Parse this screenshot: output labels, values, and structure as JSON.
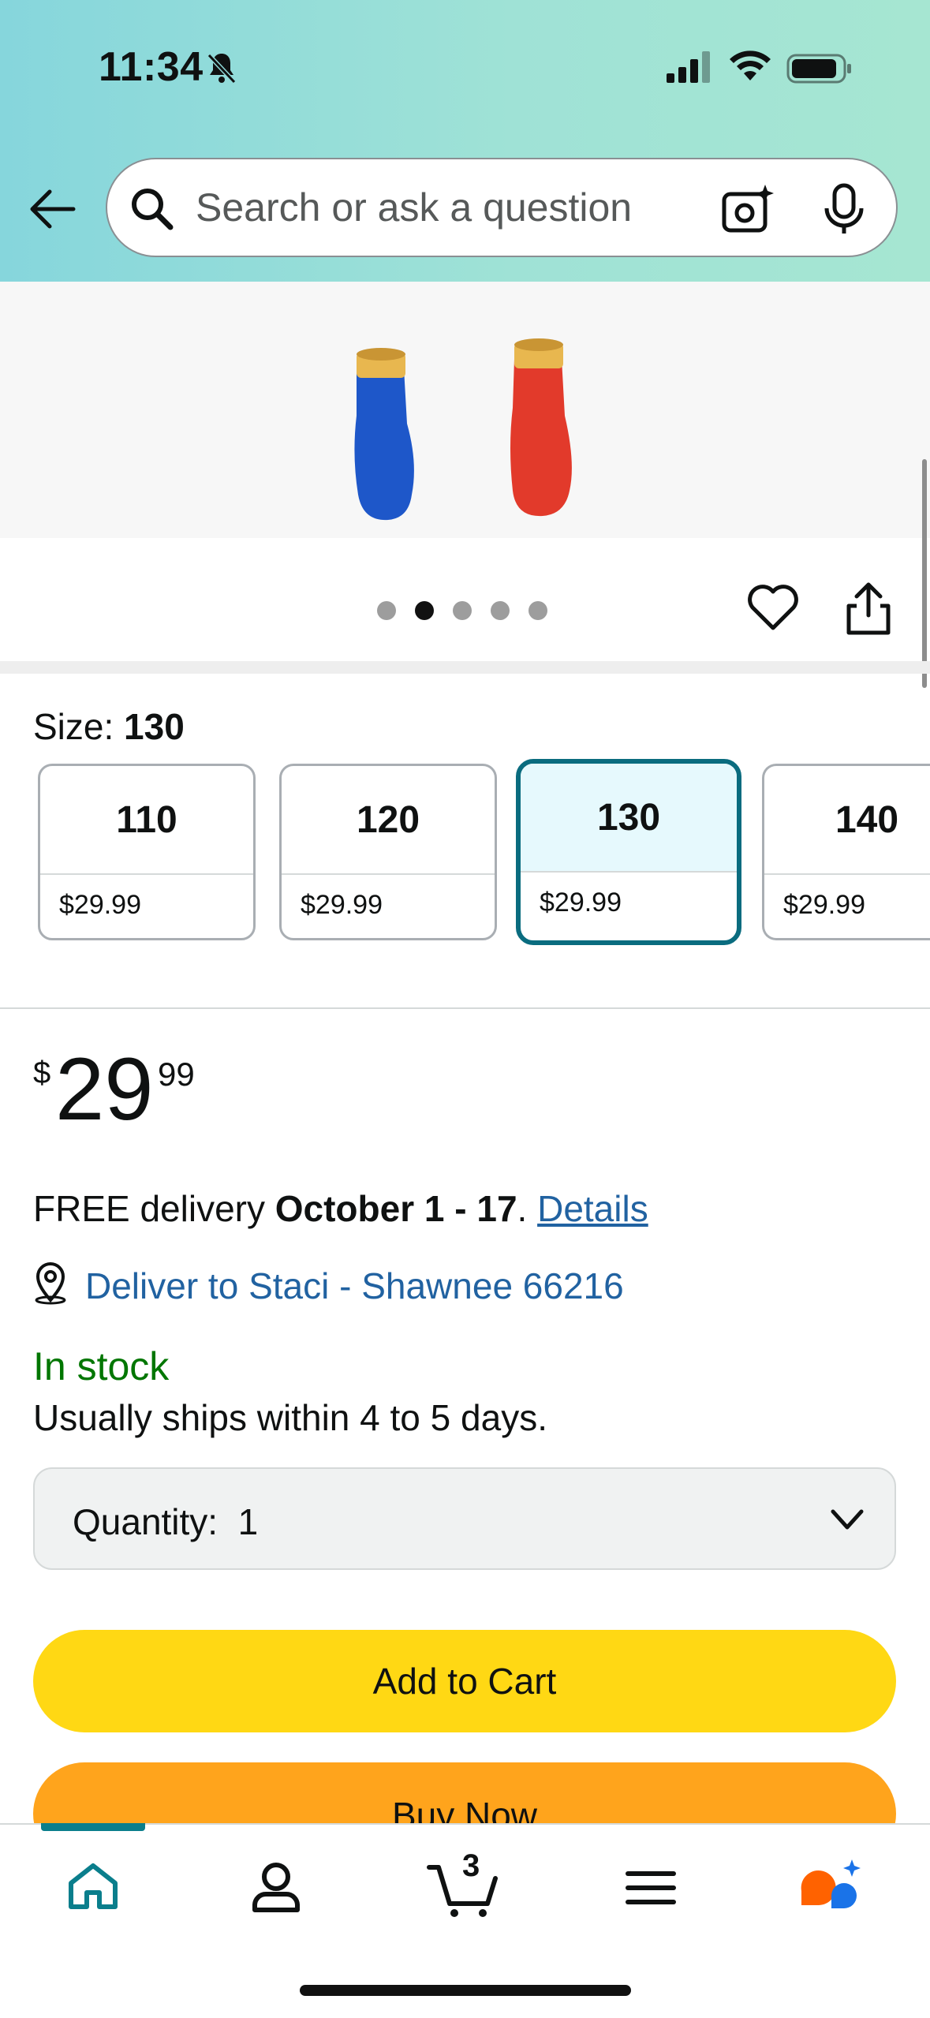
{
  "status": {
    "time": "11:34"
  },
  "search": {
    "placeholder": "Search or ask a question"
  },
  "gallery": {
    "dots": 5,
    "active_index": 1
  },
  "size": {
    "label": "Size: ",
    "selected": "130",
    "options": [
      {
        "size": "110",
        "price": "$29.99"
      },
      {
        "size": "120",
        "price": "$29.99"
      },
      {
        "size": "130",
        "price": "$29.99"
      },
      {
        "size": "140",
        "price": "$29.99"
      }
    ]
  },
  "price": {
    "symbol": "$",
    "whole": "29",
    "fraction": "99"
  },
  "delivery": {
    "prefix": "FREE delivery ",
    "dates": "October 1 - 17",
    "suffix": ". ",
    "details_link": "Details",
    "deliver_to": "Deliver to Staci - Shawnee 66216"
  },
  "availability": {
    "stock": "In stock",
    "ships": "Usually ships within 4 to 5 days."
  },
  "quantity": {
    "label": "Quantity:",
    "value": "1"
  },
  "buttons": {
    "add_to_cart": "Add to Cart",
    "buy_now": "Buy Now"
  },
  "nav": {
    "cart_count": "3"
  },
  "colors": {
    "header_start": "#86d6dc",
    "teal": "#0a6c7f",
    "add_to_cart": "#ffd814",
    "buy_now": "#ffa41c",
    "link": "#2162a1",
    "in_stock": "#007600"
  }
}
